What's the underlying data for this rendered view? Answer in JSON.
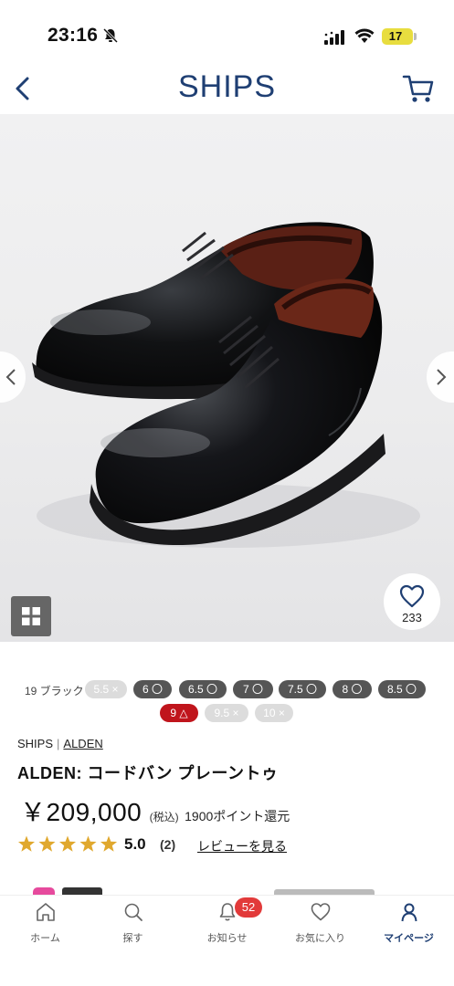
{
  "status_bar": {
    "time": "23:16",
    "battery": "17"
  },
  "header": {
    "logo": "SHIPS",
    "back_icon": "chevron-left-icon",
    "cart_icon": "cart-icon"
  },
  "gallery": {
    "favorite_count": "233"
  },
  "variants": {
    "color_name": "19 ブラック",
    "sizes": [
      {
        "label": "5.5 ×",
        "status": "unavailable"
      },
      {
        "label": "6 〇",
        "status": "available"
      },
      {
        "label": "6.5 〇",
        "status": "available"
      },
      {
        "label": "7 〇",
        "status": "available"
      },
      {
        "label": "7.5 〇",
        "status": "available"
      },
      {
        "label": "8 〇",
        "status": "available"
      },
      {
        "label": "8.5 〇",
        "status": "available"
      },
      {
        "label": "9 △",
        "status": "selected"
      },
      {
        "label": "9.5 ×",
        "status": "unavailable"
      },
      {
        "label": "10 ×",
        "status": "unavailable"
      }
    ]
  },
  "product": {
    "shop": "SHIPS",
    "brand": "ALDEN",
    "title": "ALDEN: コードバン プレーントゥ",
    "price": "￥209,000",
    "tax_note": "(税込)",
    "points": "1900ポイント還元",
    "rating": 5.0,
    "rating_text": "5.0",
    "review_count": "(2)",
    "review_link": "レビューを見る"
  },
  "tab_bar": {
    "items": [
      {
        "label": "ホーム",
        "icon": "home-icon"
      },
      {
        "label": "探す",
        "icon": "search-icon"
      },
      {
        "label": "お知らせ",
        "icon": "bell-icon",
        "badge": "52"
      },
      {
        "label": "お気に入り",
        "icon": "heart-icon"
      },
      {
        "label": "マイページ",
        "icon": "person-icon",
        "active": true
      }
    ]
  },
  "colors": {
    "brand_navy": "#1f3f73",
    "sold_out_red": "#c0151c",
    "star_gold": "#e0a82e",
    "badge_red": "#e23a3a"
  }
}
